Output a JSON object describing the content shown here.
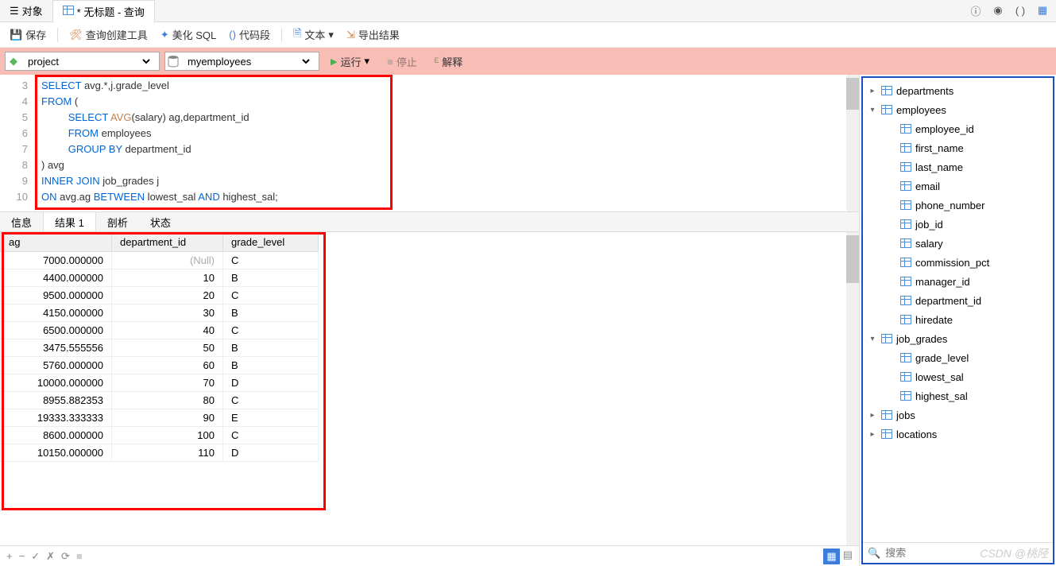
{
  "tabs": {
    "objects": "对象",
    "query": "* 无标题 - 查询"
  },
  "toolbar1": {
    "save": "保存",
    "query_builder": "查询创建工具",
    "beautify": "美化 SQL",
    "snippet": "代码段",
    "text": "文本",
    "export": "导出结果"
  },
  "toolbar2": {
    "project": "project",
    "database": "myemployees",
    "run": "运行",
    "stop": "停止",
    "explain": "解释"
  },
  "code": {
    "lines": [
      "3",
      "4",
      "5",
      "6",
      "7",
      "8",
      "9",
      "10"
    ],
    "l3a": "SELECT",
    "l3b": " avg.*,j.grade_level",
    "l4a": "FROM",
    "l4b": " (",
    "l5a": "SELECT",
    "l5b": " AVG",
    "l5c": "(salary) ag,department_id",
    "l6a": "FROM",
    "l6b": " employees",
    "l7a": "GROUP BY",
    "l7b": " department_id",
    "l8": ") avg",
    "l9a": "INNER JOIN",
    "l9b": " job_grades j",
    "l10a": "ON",
    "l10b": " avg.ag ",
    "l10c": "BETWEEN",
    "l10d": " lowest_sal ",
    "l10e": "AND",
    "l10f": " highest_sal;"
  },
  "result_tabs": {
    "info": "信息",
    "results": "结果 1",
    "profile": "剖析",
    "status": "状态"
  },
  "grid": {
    "cols": {
      "ag": "ag",
      "dept": "department_id",
      "grade": "grade_level"
    },
    "null": "(Null)",
    "rows": [
      {
        "ag": "7000.000000",
        "dept": "(Null)",
        "grade": "C"
      },
      {
        "ag": "4400.000000",
        "dept": "10",
        "grade": "B"
      },
      {
        "ag": "9500.000000",
        "dept": "20",
        "grade": "C"
      },
      {
        "ag": "4150.000000",
        "dept": "30",
        "grade": "B"
      },
      {
        "ag": "6500.000000",
        "dept": "40",
        "grade": "C"
      },
      {
        "ag": "3475.555556",
        "dept": "50",
        "grade": "B"
      },
      {
        "ag": "5760.000000",
        "dept": "60",
        "grade": "B"
      },
      {
        "ag": "10000.000000",
        "dept": "70",
        "grade": "D"
      },
      {
        "ag": "8955.882353",
        "dept": "80",
        "grade": "C"
      },
      {
        "ag": "19333.333333",
        "dept": "90",
        "grade": "E"
      },
      {
        "ag": "8600.000000",
        "dept": "100",
        "grade": "C"
      },
      {
        "ag": "10150.000000",
        "dept": "110",
        "grade": "D"
      }
    ]
  },
  "tree": {
    "departments": "departments",
    "employees": "employees",
    "emp_cols": [
      "employee_id",
      "first_name",
      "last_name",
      "email",
      "phone_number",
      "job_id",
      "salary",
      "commission_pct",
      "manager_id",
      "department_id",
      "hiredate"
    ],
    "job_grades": "job_grades",
    "jg_cols": [
      "grade_level",
      "lowest_sal",
      "highest_sal"
    ],
    "jobs": "jobs",
    "locations": "locations"
  },
  "search": {
    "placeholder": "搜索"
  },
  "watermark": "CSDN @桃陉"
}
